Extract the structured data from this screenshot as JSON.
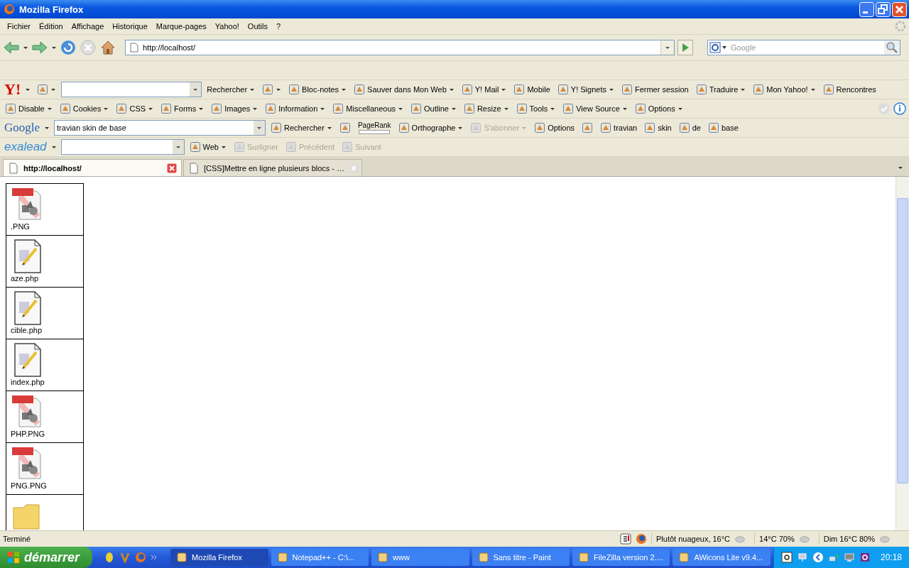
{
  "window": {
    "title": "Mozilla Firefox"
  },
  "menu": [
    "Fichier",
    "Édition",
    "Affichage",
    "Historique",
    "Marque-pages",
    "Yahoo!",
    "Outils",
    "?"
  ],
  "navigation": {
    "url": "http://localhost/",
    "search_placeholder": "Google"
  },
  "toolbars": [
    {
      "kind": "yahoo",
      "logo": "Y!",
      "logo_dropdown": true,
      "items": [
        {
          "kind": "button",
          "icon": true,
          "dropdown": true
        },
        {
          "kind": "field"
        },
        {
          "kind": "button",
          "label": "Rechercher",
          "dropdown": true
        },
        {
          "kind": "button",
          "icon": true,
          "dropdown": true
        },
        {
          "kind": "button",
          "label": "Bloc-notes",
          "icon": true,
          "dropdown": true
        },
        {
          "kind": "button",
          "label": "Sauver dans Mon Web",
          "icon": true,
          "dropdown": true
        },
        {
          "kind": "button",
          "label": "Y! Mail",
          "icon": true,
          "dropdown": true
        },
        {
          "kind": "button",
          "label": "Mobile",
          "icon": true
        },
        {
          "kind": "button",
          "label": "Y! Signets",
          "icon": true,
          "dropdown": true
        },
        {
          "kind": "button",
          "label": "Fermer session",
          "icon": true
        },
        {
          "kind": "button",
          "label": "Traduire",
          "icon": true,
          "dropdown": true
        },
        {
          "kind": "button",
          "label": "Mon Yahoo!",
          "icon": true,
          "dropdown": true
        },
        {
          "kind": "button",
          "label": "Rencontres",
          "icon": true
        }
      ]
    },
    {
      "kind": "webdev",
      "items": [
        {
          "kind": "button",
          "label": "Disable",
          "icon": true,
          "dropdown": true
        },
        {
          "kind": "button",
          "label": "Cookies",
          "icon": true,
          "dropdown": true
        },
        {
          "kind": "button",
          "label": "CSS",
          "icon": true,
          "dropdown": true
        },
        {
          "kind": "button",
          "label": "Forms",
          "icon": true,
          "dropdown": true
        },
        {
          "kind": "button",
          "label": "Images",
          "icon": true,
          "dropdown": true
        },
        {
          "kind": "button",
          "label": "Information",
          "icon": true,
          "dropdown": true
        },
        {
          "kind": "button",
          "label": "Miscellaneous",
          "icon": true,
          "dropdown": true
        },
        {
          "kind": "button",
          "label": "Outline",
          "icon": true,
          "dropdown": true
        },
        {
          "kind": "button",
          "label": "Resize",
          "icon": true,
          "dropdown": true
        },
        {
          "kind": "button",
          "label": "Tools",
          "icon": true,
          "dropdown": true
        },
        {
          "kind": "button",
          "label": "View Source",
          "icon": true,
          "dropdown": true
        },
        {
          "kind": "button",
          "label": "Options",
          "icon": true,
          "dropdown": true
        }
      ]
    },
    {
      "kind": "google",
      "logo": "Google",
      "logo_dropdown": true,
      "items": [
        {
          "kind": "field",
          "value": "travian skin de base"
        },
        {
          "kind": "button",
          "label": "Rechercher",
          "icon": true,
          "dropdown": true,
          "disabled": false
        },
        {
          "kind": "button",
          "icon": true,
          "disabled": false
        },
        {
          "kind": "pagerank",
          "label": "PageRank",
          "disabled": false
        },
        {
          "kind": "button",
          "label": "Orthographe",
          "icon": true,
          "dropdown": true,
          "disabled": false
        },
        {
          "kind": "button",
          "label": "S'abonner",
          "icon": true,
          "dropdown": true,
          "disabled": true
        },
        {
          "kind": "button",
          "label": "Options",
          "icon": true,
          "disabled": false
        },
        {
          "kind": "button",
          "icon": true,
          "disabled": false
        },
        {
          "kind": "button",
          "label": "travian",
          "icon": true,
          "disabled": false
        },
        {
          "kind": "button",
          "label": "skin",
          "icon": true,
          "disabled": false
        },
        {
          "kind": "button",
          "label": "de",
          "icon": true,
          "disabled": false
        },
        {
          "kind": "button",
          "label": "base",
          "icon": true,
          "disabled": false
        }
      ]
    },
    {
      "kind": "exalead",
      "logo": "exalead",
      "logo_dropdown": true,
      "items": [
        {
          "kind": "field"
        },
        {
          "kind": "button",
          "label": "Web",
          "icon": true,
          "dropdown": true,
          "disabled": false
        },
        {
          "kind": "button",
          "label": "Surligner",
          "icon": true,
          "disabled": true
        },
        {
          "kind": "button",
          "label": "Précédent",
          "icon": true,
          "disabled": true
        },
        {
          "kind": "button",
          "label": "Suivant",
          "icon": true,
          "disabled": true
        }
      ]
    }
  ],
  "tabs": [
    {
      "label": "http://localhost/",
      "selected": true
    },
    {
      "label": "[CSS]Mettre en ligne plusieurs blocs - …",
      "selected": false
    }
  ],
  "files": [
    {
      "kind": "png",
      "name": ".PNG"
    },
    {
      "kind": "php",
      "name": "aze.php"
    },
    {
      "kind": "php",
      "name": "cible.php"
    },
    {
      "kind": "php",
      "name": "index.php"
    },
    {
      "kind": "png",
      "name": "PHP.PNG"
    },
    {
      "kind": "png",
      "name": "PNG.PNG"
    },
    {
      "kind": "folder"
    }
  ],
  "status_bar": {
    "text": "Terminé",
    "weather": [
      "Plutôt nuageux, 16°C",
      "14°C 70%",
      "Dim 16°C 80%"
    ]
  },
  "taskbar": {
    "start": "démarrer",
    "tasks": [
      {
        "label": "Mozilla Firefox",
        "selected": true
      },
      {
        "label": "Notepad++ - C:\\...",
        "selected": false
      },
      {
        "label": "www",
        "selected": false
      },
      {
        "label": "Sans titre - Paint",
        "selected": false
      },
      {
        "label": "FileZilla version 2....",
        "selected": false
      },
      {
        "label": "AWicons Lite v9.4...",
        "selected": false
      }
    ],
    "clock": "20:18"
  }
}
